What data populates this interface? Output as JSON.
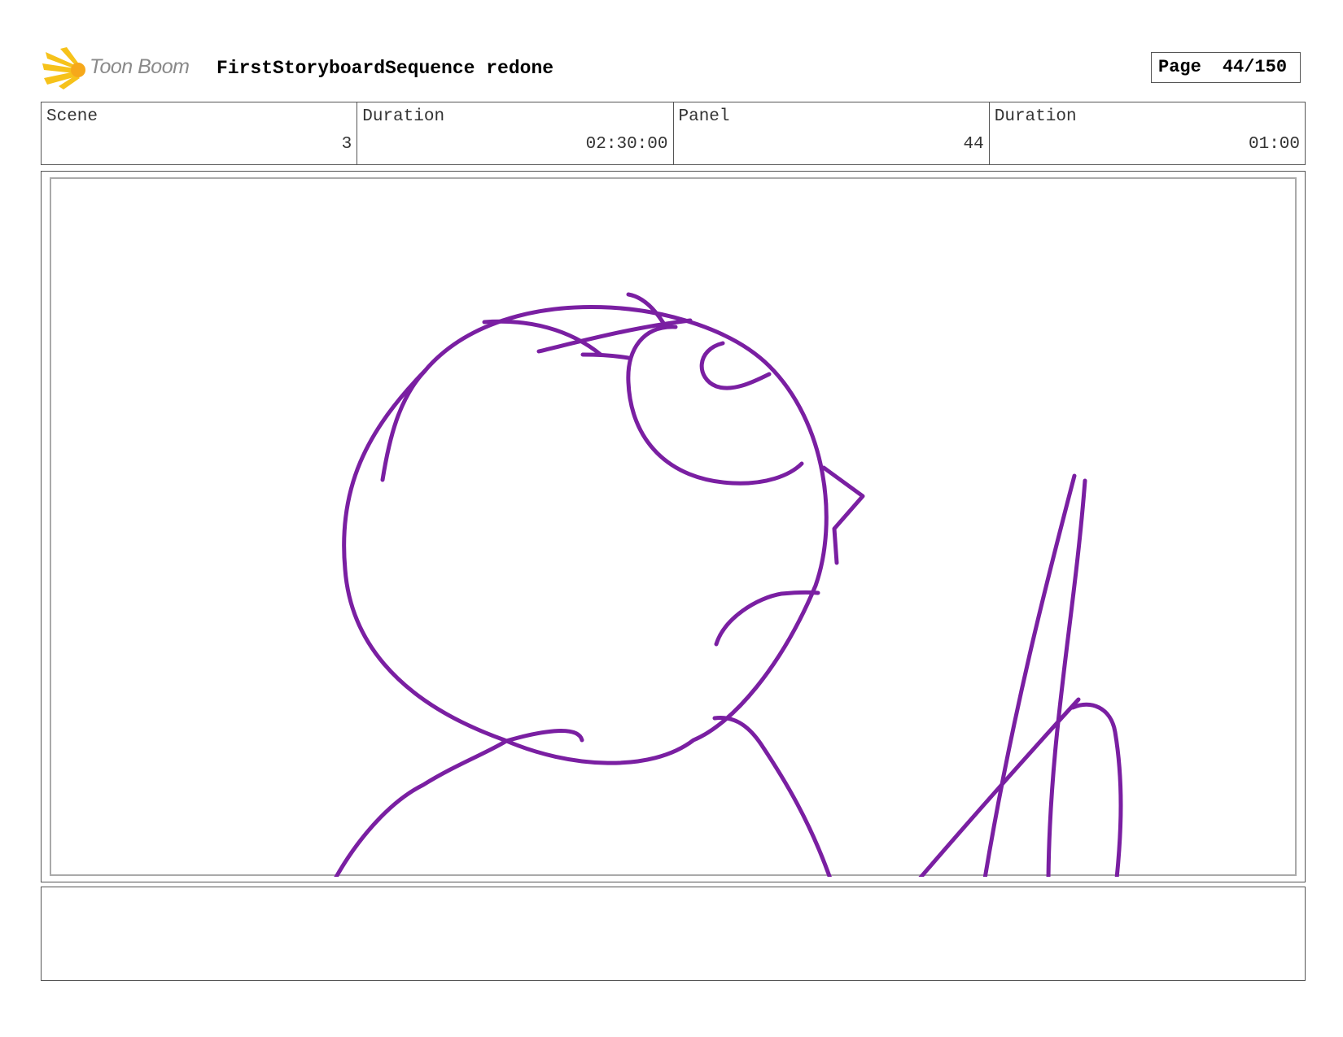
{
  "header": {
    "logo_text": "Toon Boom",
    "title": "FirstStoryboardSequence redone",
    "page_label": "Page",
    "page_number": "44/150"
  },
  "info": {
    "scene_label": "Scene",
    "scene_value": "3",
    "scene_duration_label": "Duration",
    "scene_duration_value": "02:30:00",
    "panel_label": "Panel",
    "panel_value": "44",
    "panel_duration_label": "Duration",
    "panel_duration_value": "01:00"
  },
  "colors": {
    "sketch_stroke": "#7a1fa2",
    "logo_accent": "#f6c21a"
  },
  "notes": {
    "text": ""
  }
}
